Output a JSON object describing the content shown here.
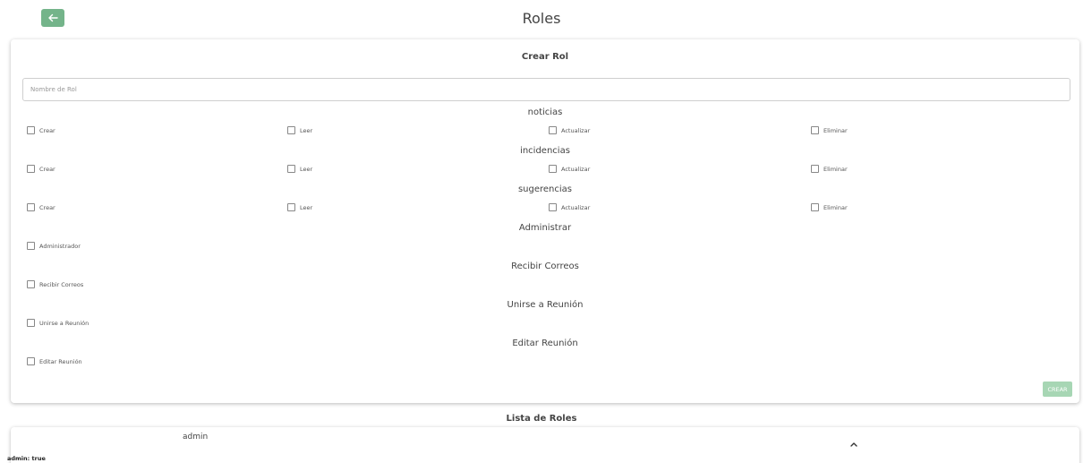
{
  "header": {
    "title": "Roles"
  },
  "form": {
    "title": "Crear Rol",
    "role_name_placeholder": "Nombre de Rol",
    "create_button": "CREAR",
    "sections": [
      {
        "title": "noticias",
        "options": [
          "Crear",
          "Leer",
          "Actualizar",
          "Eliminar"
        ]
      },
      {
        "title": "incidencias",
        "options": [
          "Crear",
          "Leer",
          "Actualizar",
          "Eliminar"
        ]
      },
      {
        "title": "sugerencias",
        "options": [
          "Crear",
          "Leer",
          "Actualizar",
          "Eliminar"
        ]
      },
      {
        "title": "Administrar",
        "options": [
          "Administrador"
        ]
      },
      {
        "title": "Recibir Correos",
        "options": [
          "Recibir Correos"
        ]
      },
      {
        "title": "Unirse a Reunión",
        "options": [
          "Unirse a Reunión"
        ]
      },
      {
        "title": "Editar Reunión",
        "options": [
          "Editar Reunión"
        ]
      }
    ]
  },
  "roles_list": {
    "title": "Lista de Roles",
    "items": [
      {
        "name": "admin",
        "detail": "admin: true"
      }
    ]
  },
  "colors": {
    "accent": "#74b48a",
    "create_button": "#a7d6b4"
  },
  "icons": {
    "back": "arrow-left-icon",
    "expand": "chevron-up-icon"
  }
}
